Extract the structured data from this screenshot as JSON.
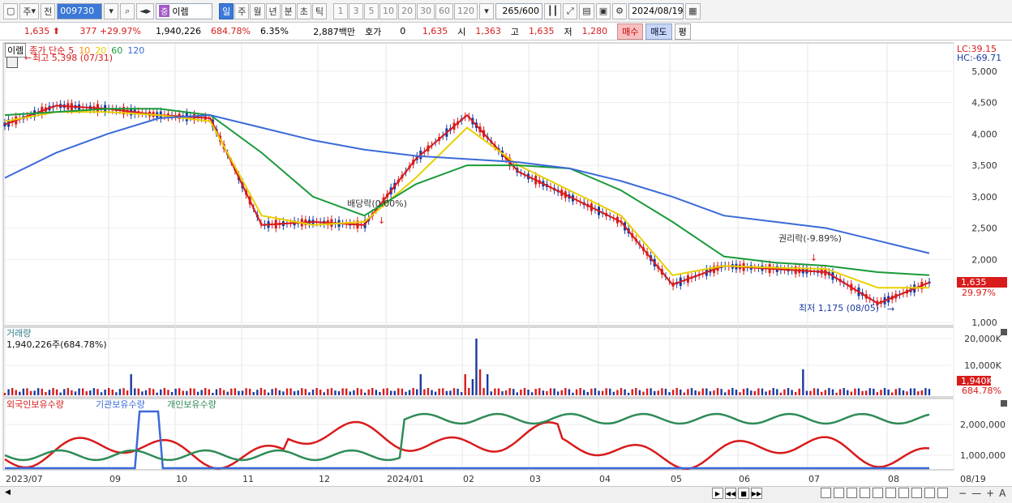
{
  "toolbar": {
    "mode_primary": "주",
    "prev_label": "전",
    "stock_code": "009730",
    "stock_badge": "중",
    "stock_name": "이렘",
    "period_buttons": [
      "일",
      "주",
      "월",
      "년",
      "분",
      "초",
      "틱"
    ],
    "active_period": "일",
    "interval_buttons": [
      "1",
      "3",
      "5",
      "10",
      "20",
      "30",
      "60",
      "120"
    ],
    "count_value": "265",
    "count_total": "/600",
    "date_value": "2024/08/19"
  },
  "quote": {
    "price": "1,635",
    "change": "377",
    "change_pct": "+29.97%",
    "volume": "1,940,226",
    "volume_ratio": "684.78%",
    "turnover": "6.35%",
    "amount": "2,887백만",
    "bid_label": "호가",
    "bid_value": "0",
    "bid_price": "1,635",
    "open_label": "시",
    "open_value": "1,363",
    "high_label": "고",
    "high_value": "1,635",
    "low_label": "저",
    "low_value": "1,280",
    "buy_label": "매수",
    "sell_label": "매도",
    "eval_label": "평"
  },
  "legend": {
    "name": "이렘",
    "ma_prefix": "종가 단순",
    "ma_periods": [
      "5",
      "10",
      "20",
      "60",
      "120"
    ],
    "ma_colors": [
      "#d81b1b",
      "#ff8c00",
      "#e8d000",
      "#1a9a3a",
      "#3a6ad8"
    ],
    "high_annotation": "최고 5,398 (07/31)",
    "low_annotation": "최저 1,175 (08/05)",
    "dividend_annotation": "배당락(0.00%)",
    "rights_annotation": "권리락(-9.89%)",
    "lc_label": "LC:39.15",
    "hc_label": "HC:-69.71"
  },
  "price_axis": {
    "ticks": [
      "5,000",
      "4,500",
      "4,000",
      "3,500",
      "3,000",
      "2,500",
      "2,000",
      "1,000"
    ],
    "current_price_tag": "1,635",
    "current_pct_tag": "29.97%"
  },
  "volume_panel": {
    "title": "거래량",
    "value_text": "1,940,226주(684.78%)",
    "ticks": [
      "20,000K",
      "10,000K"
    ],
    "current_tag": "1,940K",
    "current_pct": "684.78%"
  },
  "holdings_panel": {
    "labels": [
      "외국인보유수량",
      "기관보유수량",
      "개인보유수량"
    ],
    "colors": [
      "#d81b1b",
      "#3a6ad8",
      "#2e8b57"
    ],
    "ticks": [
      "2,000,000",
      "1,000,000"
    ]
  },
  "time_axis": {
    "labels": [
      "2023/07",
      "09",
      "10",
      "11",
      "12",
      "2024/01",
      "02",
      "03",
      "04",
      "05",
      "06",
      "07",
      "08",
      "08/19"
    ]
  },
  "chart_data": {
    "type": "line",
    "title": "",
    "series": [
      {
        "name": "5",
        "values": [
          4150,
          4450,
          4400,
          4300,
          4250,
          2550,
          2600,
          2550,
          3600,
          4300,
          3400,
          3000,
          2600,
          1600,
          1900,
          1850,
          1800,
          1300,
          1635
        ]
      },
      {
        "name": "20",
        "values": [
          4200,
          4350,
          4350,
          4300,
          4200,
          2700,
          2550,
          2600,
          3300,
          4100,
          3500,
          3100,
          2700,
          1750,
          1900,
          1870,
          1850,
          1550,
          1550
        ]
      },
      {
        "name": "60",
        "values": [
          4300,
          4350,
          4400,
          4400,
          4300,
          3700,
          3000,
          2700,
          3200,
          3500,
          3500,
          3450,
          3100,
          2600,
          2050,
          1950,
          1900,
          1800,
          1750
        ]
      },
      {
        "name": "120",
        "values": [
          3300,
          3700,
          4000,
          4250,
          4300,
          4100,
          3900,
          3750,
          3650,
          3600,
          3550,
          3450,
          3250,
          3000,
          2700,
          2600,
          2500,
          2300,
          2100
        ]
      }
    ],
    "ylim": [
      1000,
      5500
    ]
  }
}
